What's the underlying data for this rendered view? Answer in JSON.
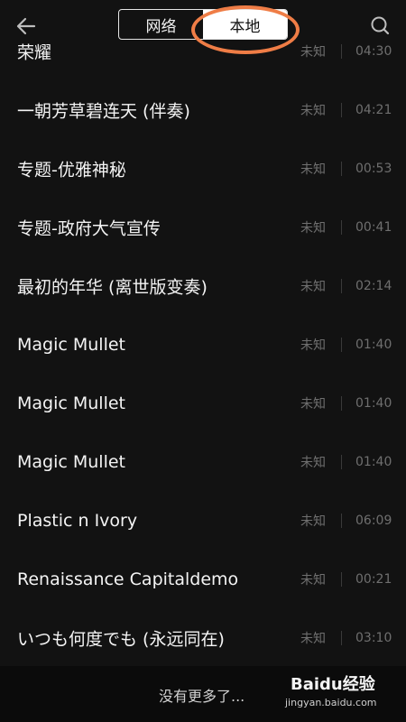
{
  "header": {
    "tabs": [
      {
        "label": "网络",
        "active": false
      },
      {
        "label": "本地",
        "active": true
      }
    ]
  },
  "tracks": [
    {
      "title": "荣耀",
      "artist": "未知",
      "duration": "04:30"
    },
    {
      "title": "一朝芳草碧连天 (伴奏)",
      "artist": "未知",
      "duration": "04:21"
    },
    {
      "title": "专题-优雅神秘",
      "artist": "未知",
      "duration": "00:53"
    },
    {
      "title": "专题-政府大气宣传",
      "artist": "未知",
      "duration": "00:41"
    },
    {
      "title": "最初的年华 (离世版变奏)",
      "artist": "未知",
      "duration": "02:14"
    },
    {
      "title": "Magic Mullet",
      "artist": "未知",
      "duration": "01:40"
    },
    {
      "title": "Magic Mullet",
      "artist": "未知",
      "duration": "01:40"
    },
    {
      "title": "Magic Mullet",
      "artist": "未知",
      "duration": "01:40"
    },
    {
      "title": "Plastic n Ivory",
      "artist": "未知",
      "duration": "06:09"
    },
    {
      "title": "Renaissance Capitaldemo",
      "artist": "未知",
      "duration": "00:21"
    },
    {
      "title": "いつも何度でも (永远同在)",
      "artist": "未知",
      "duration": "03:10"
    }
  ],
  "footer": {
    "no_more": "没有更多了..."
  },
  "watermark": {
    "brand": "Baidu经验",
    "url": "jingyan.baidu.com"
  },
  "colors": {
    "background": "#121212",
    "annotation": "#ef7d46"
  }
}
